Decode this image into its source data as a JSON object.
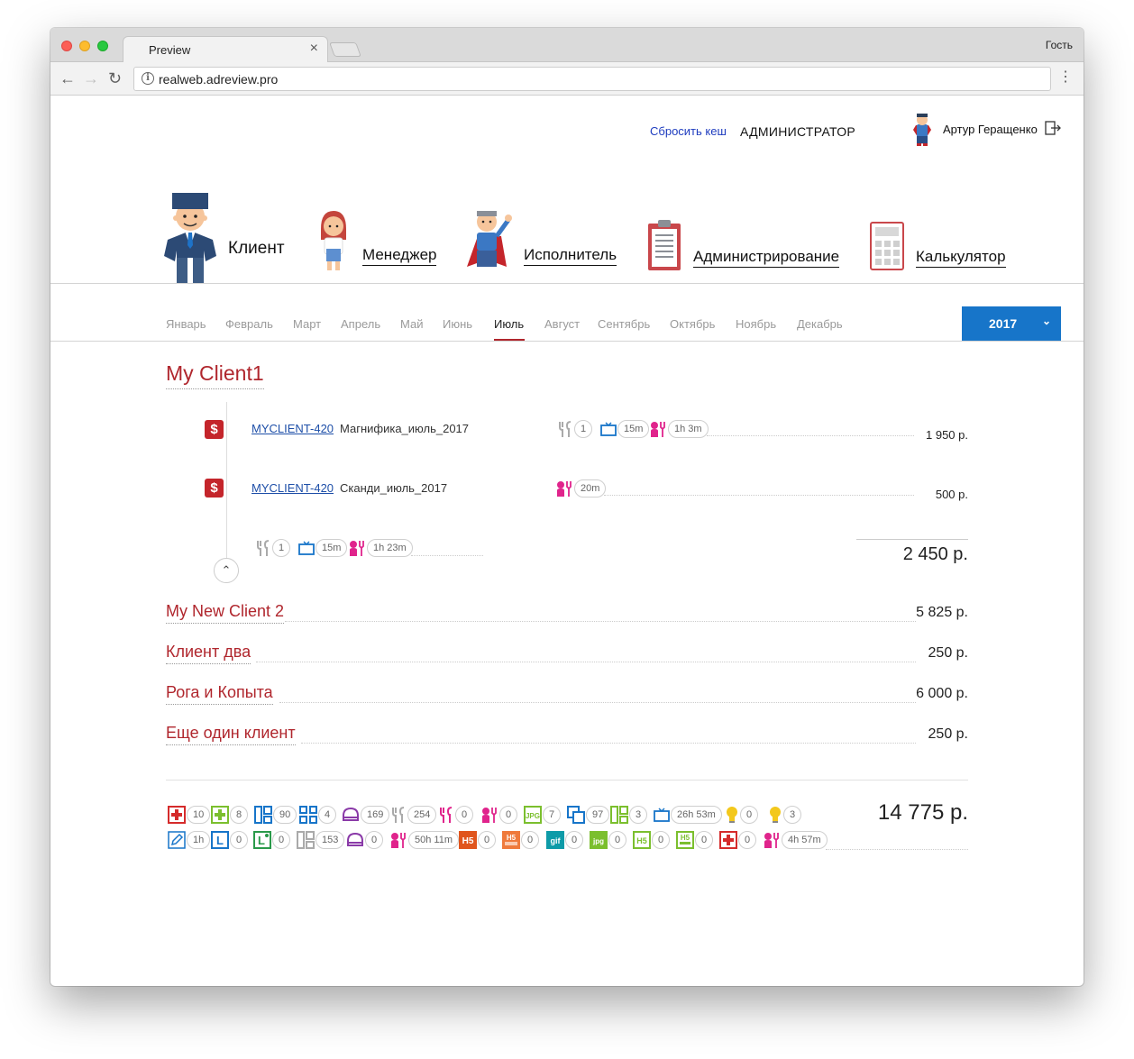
{
  "browser": {
    "tab_title": "Preview",
    "tab_close": "×",
    "guest_label": "Гость",
    "url": "realweb.adreview.pro",
    "back": "←",
    "forward": "→",
    "reload": "↻",
    "menu": "⋮",
    "info": "i"
  },
  "header": {
    "reset_cache": "Сбросить кеш",
    "role": "АДМИНИСТРАТОР",
    "user_name": "Артур Геращенко"
  },
  "roles_nav": {
    "items": [
      {
        "label": "Клиент",
        "active": true
      },
      {
        "label": "Менеджер"
      },
      {
        "label": "Исполнитель"
      },
      {
        "label": "Администрирование"
      },
      {
        "label": "Калькулятор"
      }
    ]
  },
  "months": {
    "items": [
      "Январь",
      "Февраль",
      "Март",
      "Апрель",
      "Май",
      "Июнь",
      "Июль",
      "Август",
      "Сентябрь",
      "Октябрь",
      "Ноябрь",
      "Декабрь"
    ],
    "selected": "Июль"
  },
  "year_selector": {
    "value": "2017",
    "chevron": "⌄"
  },
  "expanded_client": {
    "name": "My Client1",
    "tasks": [
      {
        "id": "MYCLIENT-420",
        "name": "Магнифика_июль_2017",
        "price": "1 950 р.",
        "metrics": [
          {
            "icon": "wrench-icon",
            "value": "1"
          },
          {
            "icon": "tv-icon",
            "value": "15m"
          },
          {
            "icon": "developer-icon",
            "value": "1h 3m"
          }
        ],
        "badge": "$"
      },
      {
        "id": "MYCLIENT-420",
        "name": "Сканди_июль_2017",
        "price": "500 р.",
        "metrics": [
          {
            "icon": "developer-icon",
            "value": "20m"
          }
        ],
        "badge": "$"
      }
    ],
    "summary_metrics": [
      {
        "icon": "wrench-icon",
        "value": "1"
      },
      {
        "icon": "tv-icon",
        "value": "15m"
      },
      {
        "icon": "developer-icon",
        "value": "1h 23m"
      }
    ],
    "total": "2 450 р.",
    "collapse": "⌃"
  },
  "clients": [
    {
      "name": "My New Client 2",
      "price": "5 825 р."
    },
    {
      "name": "Клиент два",
      "price": "250 р."
    },
    {
      "name": "Рога и Копыта",
      "price": "6 000 р."
    },
    {
      "name": "Еще один клиент",
      "price": "250 р."
    }
  ],
  "summary": {
    "grand_total": "14 775 р.",
    "row1": [
      {
        "icon": "red-plus-icon",
        "value": "10"
      },
      {
        "icon": "green-plus-icon",
        "value": "8"
      },
      {
        "icon": "blue-layout-icon",
        "value": "90"
      },
      {
        "icon": "blue-grid-icon",
        "value": "4"
      },
      {
        "icon": "purple-dome-icon",
        "value": "169"
      },
      {
        "icon": "grey-wrench-icon",
        "value": "254"
      },
      {
        "icon": "pink-wrench-icon",
        "value": "0"
      },
      {
        "icon": "pink-developer-icon",
        "value": "0"
      },
      {
        "icon": "jpg-green-icon",
        "value": "7",
        "label": "JPG"
      },
      {
        "icon": "blue-copy-icon",
        "value": "97"
      },
      {
        "icon": "green-layout-icon",
        "value": "3"
      },
      {
        "icon": "blue-tv-icon",
        "value": "26h 53m"
      },
      {
        "icon": "bulb-icon",
        "value": "0"
      },
      {
        "icon": "bulb-icon",
        "value": "3"
      }
    ],
    "row2": [
      {
        "icon": "pencil-icon",
        "value": "1h"
      },
      {
        "icon": "l-icon",
        "value": "0",
        "label": "L"
      },
      {
        "icon": "lc-icon",
        "value": "0",
        "label": "L"
      },
      {
        "icon": "grey-layout-icon",
        "value": "153"
      },
      {
        "icon": "purple-dome-icon",
        "value": "0"
      },
      {
        "icon": "pink-developer-icon",
        "value": "50h 11m"
      },
      {
        "icon": "h5-orange-icon",
        "value": "0",
        "label": "H5"
      },
      {
        "icon": "h5-lite-orange-icon",
        "value": "0",
        "label": "H5"
      },
      {
        "icon": "gif-teal-icon",
        "value": "0",
        "label": "gif"
      },
      {
        "icon": "jpg-solid-green-icon",
        "value": "0",
        "label": "jpg"
      },
      {
        "icon": "h5-green-icon",
        "value": "0",
        "label": "H5"
      },
      {
        "icon": "h5-lite-green-icon",
        "value": "0",
        "label": "H5"
      },
      {
        "icon": "red-plus-icon",
        "value": "0"
      },
      {
        "icon": "pink-developer-icon",
        "value": "4h 57m"
      }
    ]
  },
  "colors": {
    "accent_red": "#b0262d",
    "link_blue": "#1e4fa8",
    "year_blue": "#1775c9",
    "pink": "#e0248c",
    "teal": "#0e9ba8",
    "orange": "#e0551d",
    "green": "#7bbf2e"
  }
}
